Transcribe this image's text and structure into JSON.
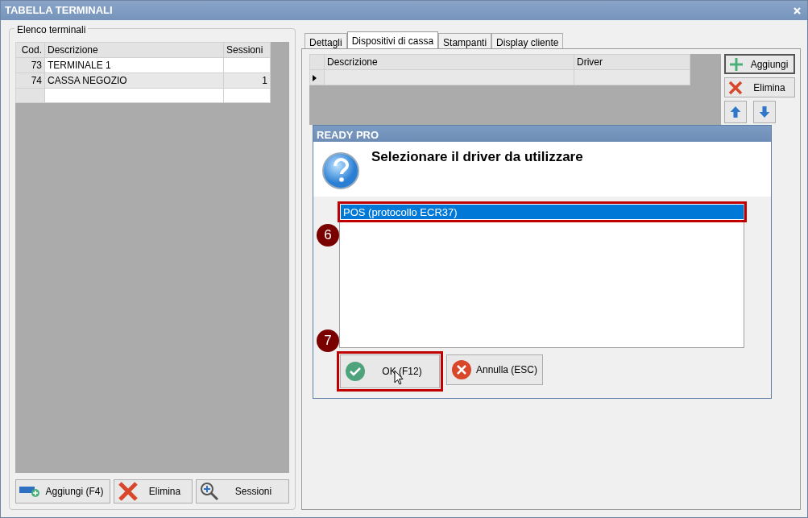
{
  "window": {
    "title": "TABELLA TERMINALI"
  },
  "terminals": {
    "legend": "Elenco terminali",
    "columns": [
      "Cod.",
      "Descrizione",
      "Sessioni"
    ],
    "rows": [
      {
        "code": "73",
        "description": "TERMINALE 1"
      },
      {
        "code": "74",
        "description": "CASSA NEGOZIO",
        "sessions": "1"
      }
    ],
    "new_row": true
  },
  "terminal_buttons": [
    {
      "label": "Aggiungi (F4)",
      "kind": "add"
    },
    {
      "label": "Elimina",
      "kind": "delete"
    },
    {
      "label": "Sessioni",
      "kind": "zoom"
    }
  ],
  "tabs": [
    {
      "label": "Dettagli",
      "selected": false
    },
    {
      "label": "Dispositivi di cassa",
      "selected": true
    },
    {
      "label": "Stampanti",
      "selected": false
    },
    {
      "label": "Display cliente",
      "selected": false
    }
  ],
  "devices": {
    "columns": [
      "Descrizione",
      "Driver"
    ],
    "current_row": true
  },
  "device_buttons": [
    {
      "label": "Aggiungi",
      "kind": "add"
    },
    {
      "label": "Elimina",
      "kind": "delete"
    },
    {
      "kind": "up"
    },
    {
      "kind": "down"
    }
  ],
  "dialog": {
    "title": "READY PRO",
    "message": "Selezionare il driver da utilizzare",
    "options": [
      {
        "label": "POS (protocollo ECR37)",
        "selected": true,
        "highlighted": true
      }
    ],
    "buttons": [
      {
        "label": "OK (F12)",
        "kind": "ok",
        "highlighted": true
      },
      {
        "label": "Annulla (ESC)",
        "kind": "cancel",
        "highlighted": false
      }
    ]
  },
  "callouts": [
    {
      "label": "6",
      "kind": "list"
    },
    {
      "label": "7",
      "kind": "buttons"
    }
  ]
}
